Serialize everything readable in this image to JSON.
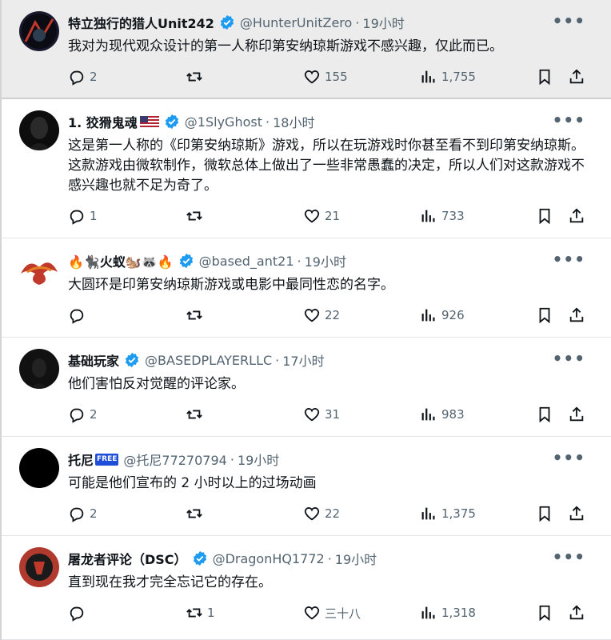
{
  "posts": [
    {
      "name": "特立独行的猎人Unit242",
      "handle": "@HunterUnitZero",
      "time": "19小时",
      "text": "我对为现代观众设计的第一人称印第安纳琼斯游戏不感兴趣，仅此而已。",
      "replies": "2",
      "reposts": "",
      "likes": "155",
      "views": "1,755",
      "verified": true,
      "highlight": true
    },
    {
      "name": "1. 狡猾鬼魂",
      "handle": "@1SlyGhost",
      "time": "18小时",
      "text": "这是第一人称的《印第安纳琼斯》游戏，所以在玩游戏时你甚至看不到印第安纳琼斯。这款游戏由微软制作，微软总体上做出了一些非常愚蠢的决定，所以人们对这款游戏不感兴趣也就不足为奇了。",
      "replies": "1",
      "reposts": "",
      "likes": "21",
      "views": "733",
      "verified": true
    },
    {
      "name": "🔥🐈‍⬛火蚁🐿️🦝🔥",
      "handle": "@based_ant21",
      "time": "19小时",
      "text": "大圆环是印第安纳琼斯游戏或电影中最同性恋的名字。",
      "replies": "",
      "reposts": "",
      "likes": "22",
      "views": "926",
      "verified": true
    },
    {
      "name": "基础玩家",
      "handle": "@BASEDPLAYERLLC",
      "time": "17小时",
      "text": "他们害怕反对觉醒的评论家。",
      "replies": "2",
      "reposts": "",
      "likes": "31",
      "views": "983",
      "verified": true
    },
    {
      "name": "托尼",
      "free_badge": "FREE",
      "handle": "@托尼77270794",
      "time": "19小时",
      "text": "可能是他们宣布的 2 小时以上的过场动画",
      "replies": "2",
      "reposts": "",
      "likes": "22",
      "views": "1,375",
      "verified": false
    },
    {
      "name": "屠龙者评论（DSC）",
      "handle": "@DragonHQ1772",
      "time": "19小时",
      "text": "直到现在我才完全忘记它的存在。",
      "replies": "",
      "reposts": "1",
      "likes": "三十八",
      "views": "1,318",
      "verified": true
    }
  ],
  "icons": {
    "more": "more-icon",
    "reply": "reply-icon",
    "repost": "repost-icon",
    "like": "like-icon",
    "views": "views-icon",
    "bookmark": "bookmark-icon",
    "share": "share-icon"
  },
  "colors": {
    "verified": "#1d9bf0",
    "muted": "#536471",
    "highlight_bg": "#ececec"
  },
  "dot": "·",
  "more_glyph": "•••"
}
